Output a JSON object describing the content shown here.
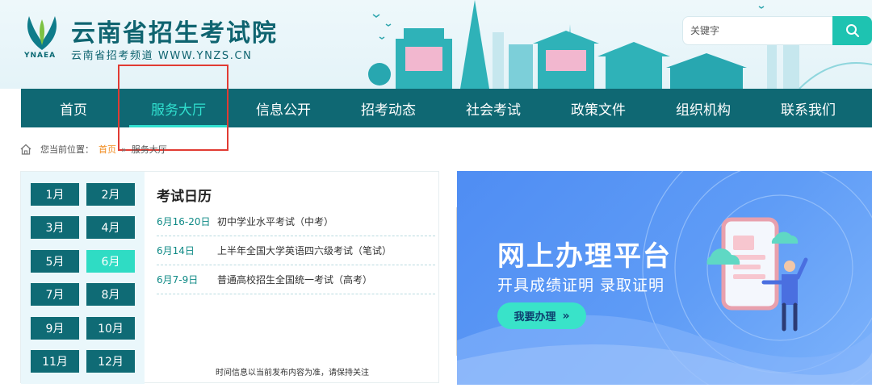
{
  "header": {
    "logo_abbr": "YNAEA",
    "site_title": "云南省招生考试院",
    "site_subtitle": "云南省招考频道 WWW.YNZS.CN",
    "search": {
      "placeholder": "关键字",
      "icon": "search-icon"
    }
  },
  "nav": {
    "items": [
      "首页",
      "服务大厅",
      "信息公开",
      "招考动态",
      "社会考试",
      "政策文件",
      "组织机构",
      "联系我们"
    ],
    "active_index": 1,
    "active_color": "#30e0cf",
    "bar_color": "#0f6873"
  },
  "breadcrumb": {
    "label": "您当前位置：",
    "home": "首页",
    "separator": "»",
    "current": "服务大厅",
    "icon": "home-icon"
  },
  "calendar": {
    "months": [
      "1月",
      "2月",
      "3月",
      "4月",
      "5月",
      "6月",
      "7月",
      "8月",
      "9月",
      "10月",
      "11月",
      "12月"
    ],
    "active_month_index": 5,
    "title": "考试日历",
    "events": [
      {
        "date": "6月16-20日",
        "name": "初中学业水平考试（中考）"
      },
      {
        "date": "6月14日",
        "name": "上半年全国大学英语四六级考试（笔试）"
      },
      {
        "date": "6月7-9日",
        "name": "普通高校招生全国统一考试（高考）"
      }
    ],
    "note": "时间信息以当前发布内容为准，请保持关注"
  },
  "banner": {
    "title": "网上办理平台",
    "subtitle": "开具成绩证明 录取证明",
    "button": "我要办理",
    "button_arrow": "»"
  }
}
